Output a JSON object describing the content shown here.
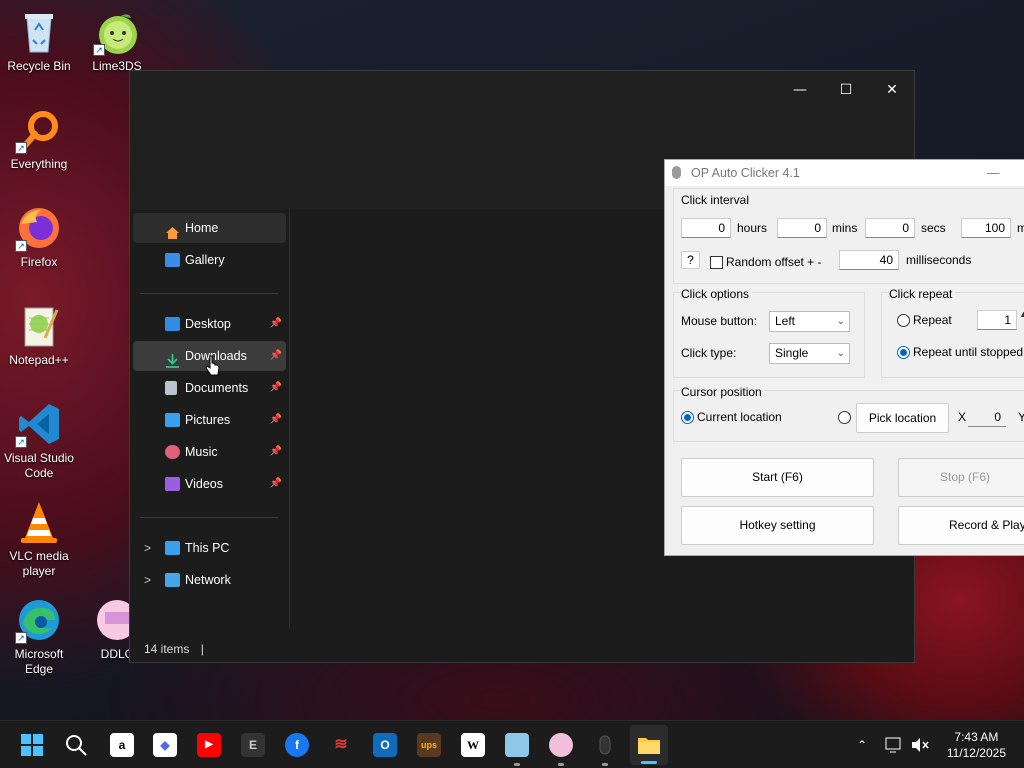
{
  "desktop": {
    "icons": [
      {
        "label": "Recycle Bin",
        "icon": "recycle-bin-icon"
      },
      {
        "label": "Lime3DS",
        "icon": "lime3ds-icon"
      },
      {
        "label": "Everything",
        "icon": "everything-icon"
      },
      {
        "label": "Firefox",
        "icon": "firefox-icon"
      },
      {
        "label": "Notepad++",
        "icon": "notepadpp-icon"
      },
      {
        "label": "Visual Studio Code",
        "icon": "vscode-icon"
      },
      {
        "label": "VLC media player",
        "icon": "vlc-icon"
      },
      {
        "label": "Microsoft Edge",
        "icon": "edge-icon"
      },
      {
        "label": "DDLC",
        "icon": "ddlc-icon"
      }
    ]
  },
  "explorer": {
    "controls": {
      "minimize": "—",
      "maximize": "☐",
      "close": "✕"
    },
    "nav": {
      "home": "Home",
      "gallery": "Gallery",
      "quick_access": [
        "Desktop",
        "Downloads",
        "Documents",
        "Pictures",
        "Music",
        "Videos"
      ],
      "this_pc": "This PC",
      "network": "Network"
    },
    "status": "14 items"
  },
  "op_auto_clicker": {
    "title": "OP Auto Clicker 4.1",
    "click_interval": {
      "label": "Click interval",
      "hours_value": "0",
      "hours_label": "hours",
      "mins_value": "0",
      "mins_label": "mins",
      "secs_value": "0",
      "secs_label": "secs",
      "ms_value": "100",
      "ms_label": "m",
      "help": "?",
      "random_offset_label": "Random offset + -",
      "random_offset_checked": false,
      "offset_value": "40",
      "offset_unit": "milliseconds"
    },
    "click_options": {
      "label": "Click options",
      "mouse_button_label": "Mouse button:",
      "mouse_button_value": "Left",
      "click_type_label": "Click type:",
      "click_type_value": "Single"
    },
    "click_repeat": {
      "label": "Click repeat",
      "repeat_label": "Repeat",
      "repeat_value": "1",
      "until_stopped_label": "Repeat until stopped",
      "selected": "until_stopped"
    },
    "cursor_position": {
      "label": "Cursor position",
      "current_label": "Current location",
      "pick_button": "Pick location",
      "x_label": "X",
      "x_value": "0",
      "y_label": "Y",
      "selected": "current"
    },
    "buttons": {
      "start": "Start (F6)",
      "stop": "Stop (F6)",
      "hotkey": "Hotkey setting",
      "record": "Record & Playba"
    }
  },
  "taskbar": {
    "apps": [
      "Start",
      "Search",
      "Amazon",
      "Copilot",
      "YouTube",
      "Epic Games",
      "Facebook",
      "Bravo",
      "Outlook",
      "UPS",
      "Wikipedia",
      "Notepad",
      "Lime3DS",
      "Mouse",
      "File Explorer"
    ],
    "time": "7:43 AM",
    "date": "11/12/2025"
  },
  "colors": {
    "accent": "#0067c0",
    "explorer_bg": "#1c1c1c",
    "taskbar_bg": "#1c1c1c"
  }
}
